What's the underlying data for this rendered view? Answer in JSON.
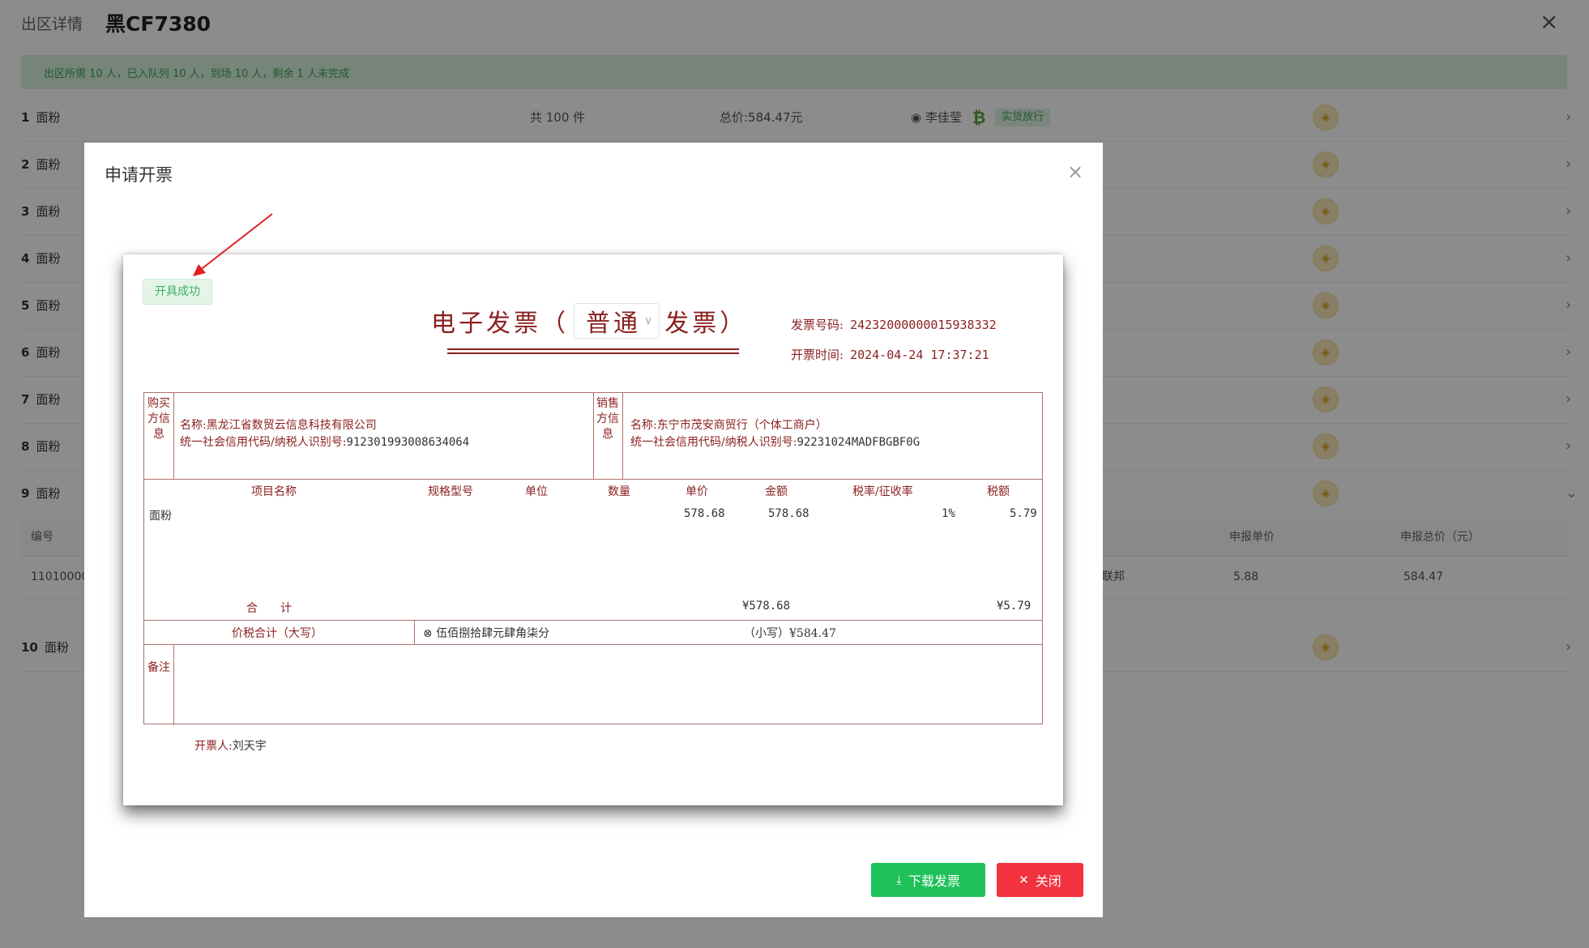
{
  "page": {
    "crumb": "出区详情",
    "plate": "黑CF7380",
    "summary": "出区所需 10 人，已入队列 10 人，到场 10 人，剩余 1 人未完成"
  },
  "rows": [
    {
      "num": "1",
      "name": "面粉",
      "qty": "共 100 件",
      "total": "总价:584.47元",
      "person": "李佳莹",
      "status": "实货放行"
    },
    {
      "num": "2",
      "name": "面粉"
    },
    {
      "num": "3",
      "name": "面粉"
    },
    {
      "num": "4",
      "name": "面粉"
    },
    {
      "num": "5",
      "name": "面粉"
    },
    {
      "num": "6",
      "name": "面粉"
    },
    {
      "num": "7",
      "name": "面粉"
    },
    {
      "num": "8",
      "name": "面粉"
    },
    {
      "num": "9",
      "name": "面粉"
    },
    {
      "num": "10",
      "name": "面粉"
    }
  ],
  "detail": {
    "headers": {
      "code": "编号",
      "unit_price": "申报单价",
      "total_price": "申报总价（元）"
    },
    "row": {
      "code": "11010000",
      "org": "联邦",
      "unit_price": "5.88",
      "total_price": "584.47"
    }
  },
  "modal": {
    "title": "申请开票",
    "close_symbol": "×",
    "success_tag": "开具成功",
    "invoice": {
      "title_prefix": "电子发票（",
      "type": "普通",
      "title_suffix": "发票）",
      "number_label": "发票号码:",
      "number": "24232000000015938332",
      "time_label": "开票时间:",
      "time": "2024-04-24 17:37:21",
      "buyer_label": "购买方信息",
      "seller_label": "销售方信息",
      "buyer_name_label": "名称:",
      "buyer_name": "黑龙江省数贸云信息科技有限公司",
      "buyer_tax_label": "统一社会信用代码/纳税人识别号:",
      "buyer_tax": "912301993008634064",
      "seller_name_label": "名称:",
      "seller_name": "东宁市茂安商贸行（个体工商户）",
      "seller_tax_label": "统一社会信用代码/纳税人识别号:",
      "seller_tax": "92231024MADFBGBF0G",
      "columns": [
        "项目名称",
        "规格型号",
        "单位",
        "数量",
        "单价",
        "金额",
        "税率/征收率",
        "税额"
      ],
      "item": {
        "name": "面粉",
        "price": "578.68",
        "amount": "578.68",
        "rate": "1%",
        "tax": "5.79"
      },
      "sum_label": "合　　计",
      "sum_amount": "¥578.68",
      "sum_tax": "¥5.79",
      "total_upper_label": "价税合计（大写）",
      "total_upper": "伍佰捌拾肆元肆角柒分",
      "total_lower": "（小写）¥584.47",
      "remark_label": "备注",
      "drawer_label": "开票人:",
      "drawer": "刘天宇"
    },
    "download_label": "下载发票",
    "close_label": "关闭"
  },
  "colors": {
    "accent_green": "#1ec15a",
    "danger_red": "#f2323c",
    "invoice_red": "#8b1f1f"
  }
}
